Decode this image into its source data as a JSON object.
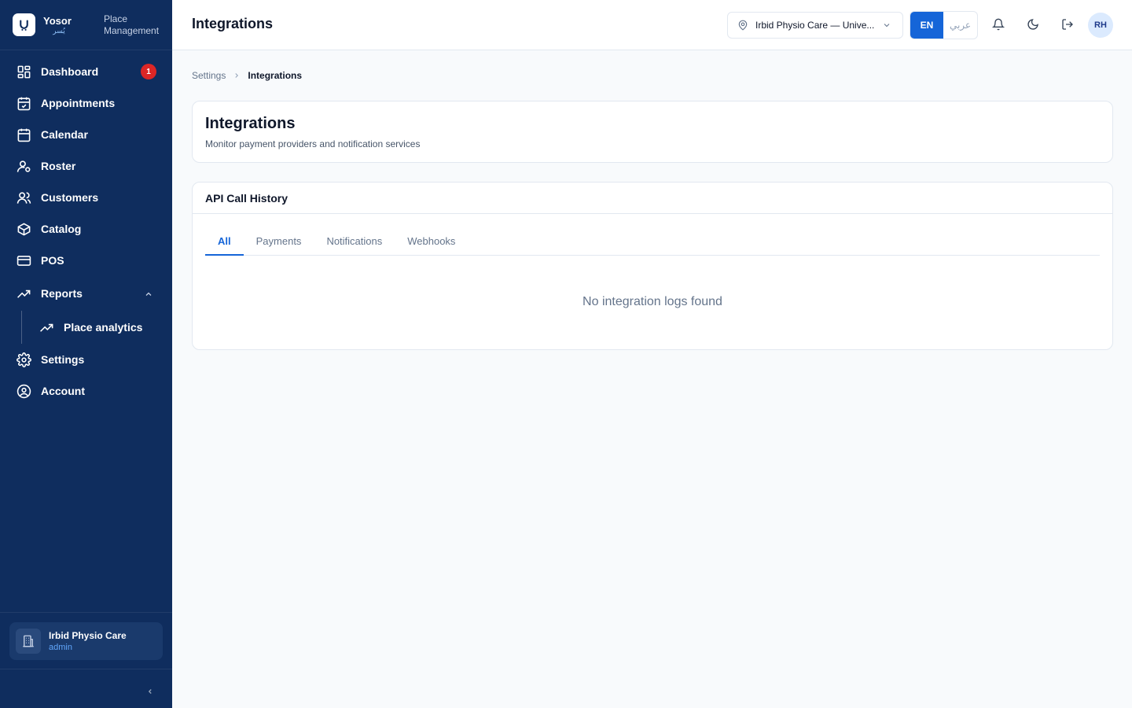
{
  "brand": {
    "name": "Yosor",
    "name_ar": "يُسر",
    "subtitle_line1": "Place",
    "subtitle_line2": "Management"
  },
  "sidebar": {
    "items": [
      {
        "label": "Dashboard",
        "icon": "dashboard-icon",
        "badge": "1"
      },
      {
        "label": "Appointments",
        "icon": "calendar-check-icon"
      },
      {
        "label": "Calendar",
        "icon": "calendar-icon"
      },
      {
        "label": "Roster",
        "icon": "user-cog-icon"
      },
      {
        "label": "Customers",
        "icon": "users-icon"
      },
      {
        "label": "Catalog",
        "icon": "box-icon"
      },
      {
        "label": "POS",
        "icon": "credit-card-icon"
      },
      {
        "label": "Reports",
        "icon": "trending-up-icon"
      },
      {
        "label": "Place analytics",
        "icon": "trending-up-icon"
      },
      {
        "label": "Settings",
        "icon": "gear-icon"
      },
      {
        "label": "Account",
        "icon": "user-circle-icon"
      }
    ],
    "place": {
      "name": "Irbid Physio Care",
      "role": "admin"
    }
  },
  "topbar": {
    "title": "Integrations",
    "place_select": "Irbid Physio Care — Unive...",
    "lang_en": "EN",
    "lang_ar": "عربي",
    "avatar_initials": "RH"
  },
  "breadcrumb": {
    "parent": "Settings",
    "current": "Integrations"
  },
  "header_card": {
    "title": "Integrations",
    "description": "Monitor payment providers and notification services"
  },
  "history": {
    "title": "API Call History",
    "tabs": [
      "All",
      "Payments",
      "Notifications",
      "Webhooks"
    ],
    "active_tab": "All",
    "empty_message": "No integration logs found"
  },
  "colors": {
    "sidebar_bg": "#0f2d5e",
    "accent": "#1565d8",
    "badge": "#dc2626"
  }
}
